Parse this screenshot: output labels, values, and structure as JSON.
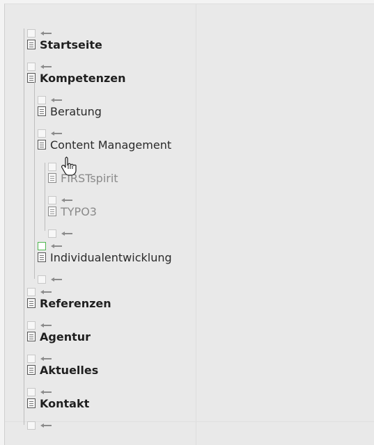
{
  "tree": {
    "items": [
      {
        "level": 0,
        "label": "Startseite",
        "bold": true,
        "muted": false
      },
      {
        "level": 0,
        "label": "Kompetenzen",
        "bold": true,
        "muted": false
      },
      {
        "level": 1,
        "label": "Beratung",
        "bold": false,
        "muted": false
      },
      {
        "level": 1,
        "label": "Content Management",
        "bold": false,
        "muted": false
      },
      {
        "level": 2,
        "label": "FIRSTspirit",
        "bold": false,
        "muted": true
      },
      {
        "level": 2,
        "label": "TYPO3",
        "bold": false,
        "muted": true
      },
      {
        "level": 1,
        "label": "Individualentwicklung",
        "bold": false,
        "muted": false
      },
      {
        "level": 0,
        "label": "Referenzen",
        "bold": true,
        "muted": false
      },
      {
        "level": 0,
        "label": "Agentur",
        "bold": true,
        "muted": false
      },
      {
        "level": 0,
        "label": "Aktuelles",
        "bold": true,
        "muted": false
      },
      {
        "level": 0,
        "label": "Kontakt",
        "bold": true,
        "muted": false
      }
    ],
    "active_drop_target_index": 7
  },
  "colors": {
    "active_drop_target": "#4fb64f",
    "text": "#2a2a2a",
    "muted_text": "#8a8a8a"
  },
  "icons": {
    "page": "page-icon",
    "drop_target": "drop-target-icon",
    "move_arrow": "arrow-left-icon",
    "cursor": "hand-pointer-cursor-icon"
  }
}
